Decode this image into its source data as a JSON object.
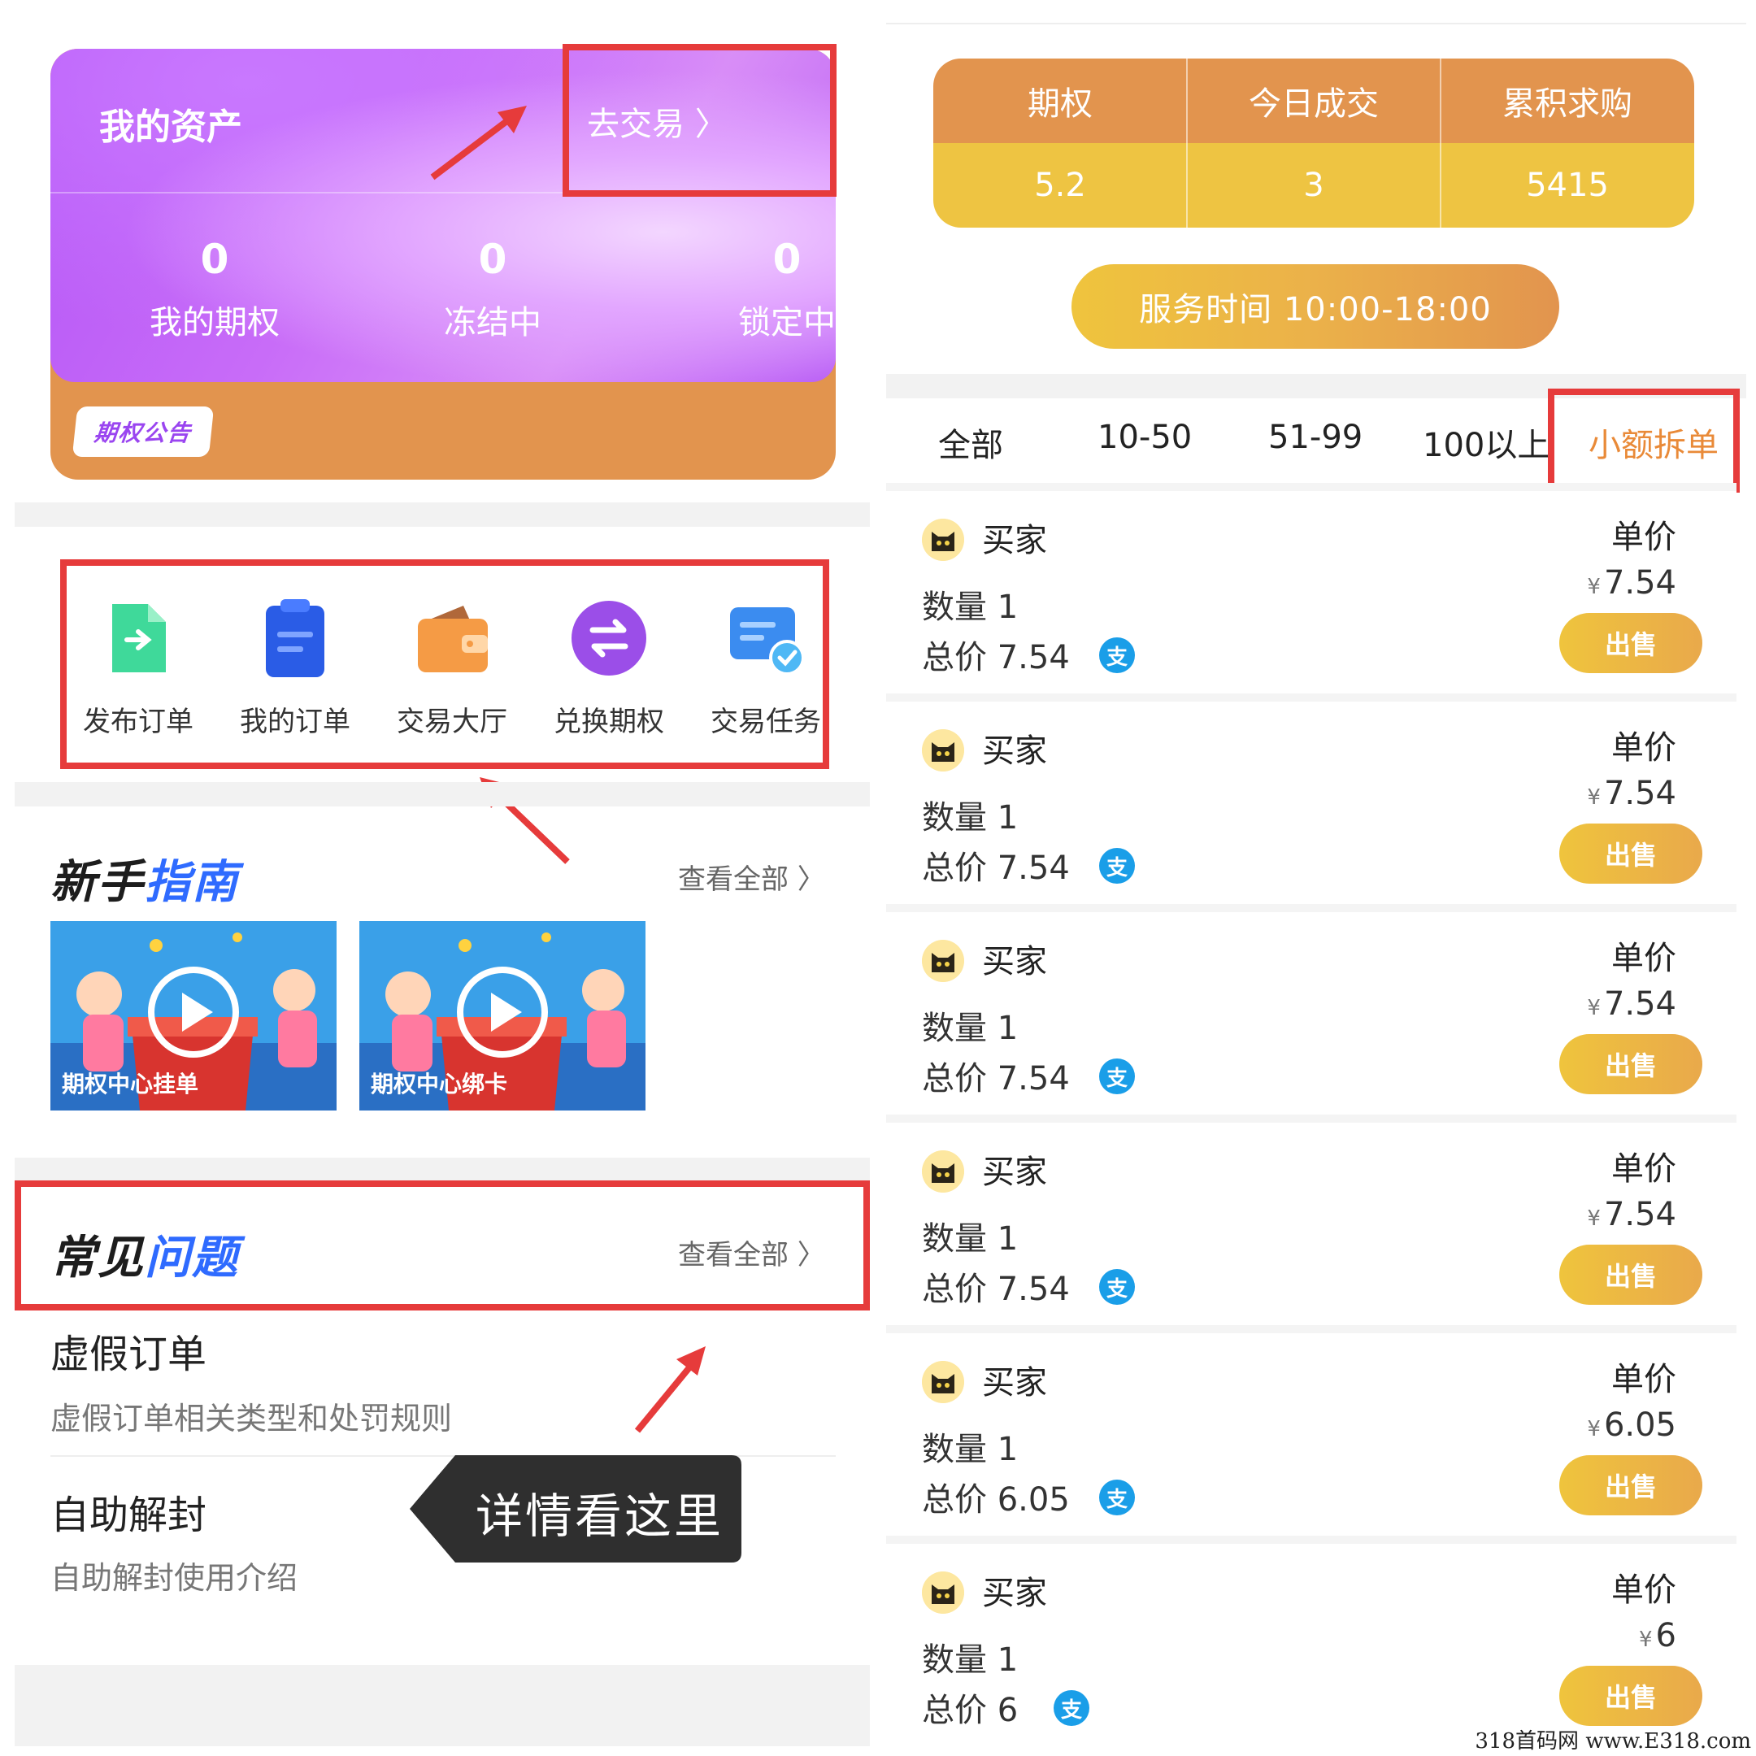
{
  "assets": {
    "title": "我的资产",
    "trade_link": "去交易 〉",
    "stats": [
      {
        "value": "0",
        "label": "我的期权"
      },
      {
        "value": "0",
        "label": "冻结中"
      },
      {
        "value": "0",
        "label": "锁定中"
      }
    ],
    "notice_badge": "期权公告"
  },
  "shortcuts": [
    {
      "label": "发布订单",
      "icon": "publish-order-icon"
    },
    {
      "label": "我的订单",
      "icon": "clipboard-icon"
    },
    {
      "label": "交易大厅",
      "icon": "wallet-icon"
    },
    {
      "label": "兑换期权",
      "icon": "exchange-icon"
    },
    {
      "label": "交易任务",
      "icon": "task-card-icon"
    }
  ],
  "guide": {
    "title_main": "新手",
    "title_highlight": "指南",
    "view_all": "查看全部 〉",
    "videos": [
      {
        "caption": "期权中心挂单"
      },
      {
        "caption": "期权中心绑卡"
      }
    ]
  },
  "faq": {
    "title_main": "常见",
    "title_highlight": "问题",
    "view_all": "查看全部 〉",
    "items": [
      {
        "title": "虚假订单",
        "desc": "虚假订单相关类型和处罚规则"
      },
      {
        "title": "自助解封",
        "desc": "自助解封使用介绍"
      }
    ]
  },
  "tooltip": "详情看这里",
  "market": {
    "headers": [
      "期权",
      "今日成交",
      "累积求购"
    ],
    "values": [
      "5.2",
      "3",
      "5415"
    ],
    "service_time": "服务时间   10:00-18:00"
  },
  "filters": {
    "tabs": [
      "全部",
      "10-50",
      "51-99",
      "100以上",
      "小额拆单"
    ],
    "active_index": 4
  },
  "listings": [
    {
      "buyer": "买家",
      "qty": "数量 1",
      "total": "总价 7.54",
      "price_label": "单价",
      "currency": "¥",
      "price": "7.54",
      "action": "出售",
      "pay": "支"
    },
    {
      "buyer": "买家",
      "qty": "数量 1",
      "total": "总价 7.54",
      "price_label": "单价",
      "currency": "¥",
      "price": "7.54",
      "action": "出售",
      "pay": "支"
    },
    {
      "buyer": "买家",
      "qty": "数量 1",
      "total": "总价 7.54",
      "price_label": "单价",
      "currency": "¥",
      "price": "7.54",
      "action": "出售",
      "pay": "支"
    },
    {
      "buyer": "买家",
      "qty": "数量 1",
      "total": "总价 7.54",
      "price_label": "单价",
      "currency": "¥",
      "price": "7.54",
      "action": "出售",
      "pay": "支"
    },
    {
      "buyer": "买家",
      "qty": "数量 1",
      "total": "总价 6.05",
      "price_label": "单价",
      "currency": "¥",
      "price": "6.05",
      "action": "出售",
      "pay": "支"
    },
    {
      "buyer": "买家",
      "qty": "数量 1",
      "total": "总价 6",
      "price_label": "单价",
      "currency": "¥",
      "price": "6",
      "action": "出售",
      "pay": "支"
    }
  ],
  "watermark": "318首码网 www.E318.com",
  "colors": {
    "orange": "#e2944e",
    "gold": "#eec442",
    "purple": "#b456f6",
    "blue_highlight": "#2f6bff",
    "annotation_red": "#e63b3b",
    "alipay_blue": "#1a9ee8"
  }
}
